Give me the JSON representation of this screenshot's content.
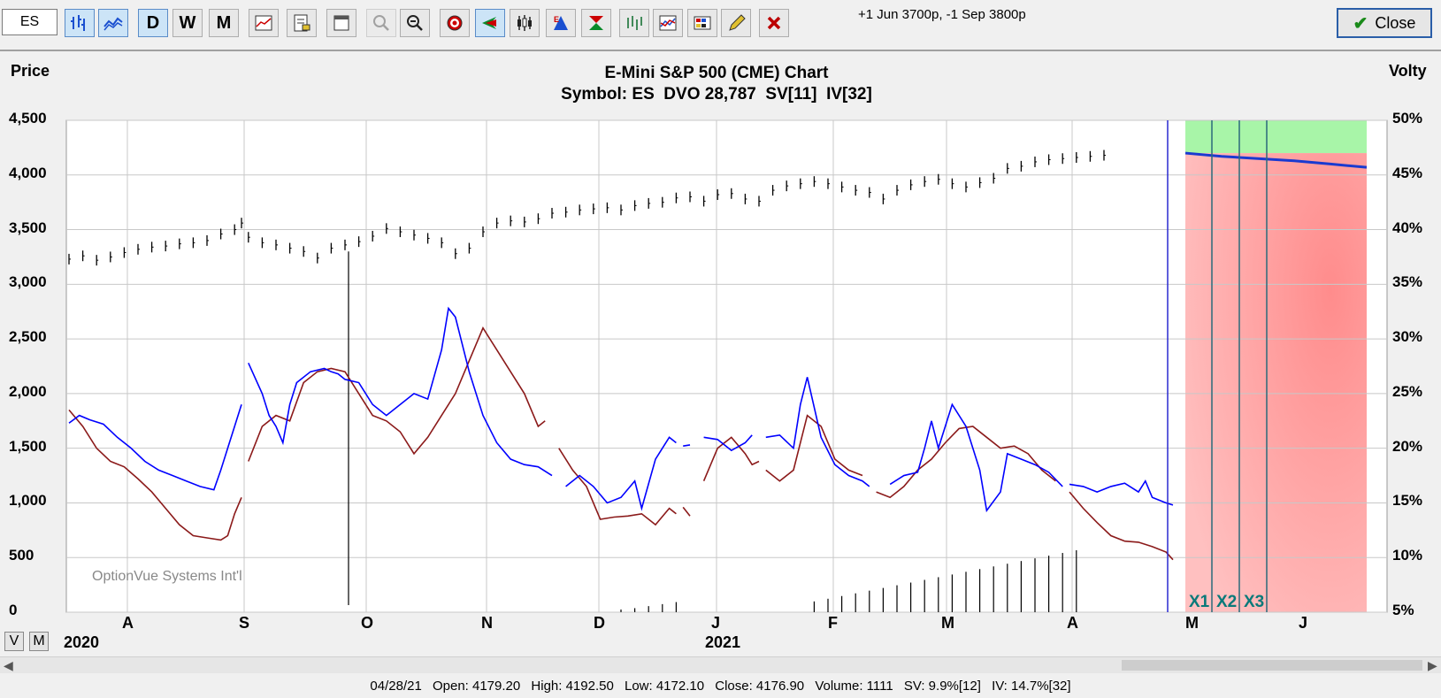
{
  "toolbar": {
    "symbol": "ES",
    "period_buttons": [
      "D",
      "W",
      "M"
    ],
    "position_note": "+1 Jun 3700p, -1 Sep 3800p",
    "close_label": "Close"
  },
  "chart": {
    "title": "E-Mini S&P 500 (CME) Chart",
    "subtitle": "Symbol: ES  DVO 28,787  SV[11]  IV[32]",
    "left_axis_title": "Price",
    "right_axis_title": "Volty",
    "watermark": "OptionVue Systems Int'l",
    "markers": [
      "X1",
      "X2",
      "X3"
    ],
    "year_labels": [
      "2020",
      "2021"
    ],
    "view_buttons": [
      "V",
      "M"
    ]
  },
  "status_bar": {
    "date": "04/28/21",
    "open": "Open: 4179.20",
    "high": "High: 4192.50",
    "low": "Low: 4172.10",
    "close": "Close: 4176.90",
    "volume": "Volume: 1111",
    "sv": "SV: 9.9%[12]",
    "iv": "IV: 14.7%[32]"
  },
  "colors": {
    "price_bars": "#000000",
    "sv_line": "#0000ff",
    "iv_line": "#8b1a1a",
    "projection_green": "#a8f5a8",
    "projection_red": "#ffaaaa",
    "marker_text": "#0a7a7a"
  },
  "chart_data": {
    "type": "line",
    "xaxis_months": [
      "A",
      "S",
      "O",
      "N",
      "D",
      "J",
      "F",
      "M",
      "A",
      "M",
      "J"
    ],
    "y_left": {
      "label": "Price",
      "ticks": [
        "4,500",
        "4,000",
        "3,500",
        "3,000",
        "2,500",
        "2,000",
        "1,500",
        "1,000",
        "500",
        "0"
      ],
      "ylim": [
        0,
        4500
      ]
    },
    "y_right": {
      "label": "Volty",
      "ticks": [
        "50%",
        "45%",
        "40%",
        "35%",
        "30%",
        "25%",
        "20%",
        "15%",
        "10%",
        "5%"
      ],
      "ylim": [
        5,
        50
      ]
    },
    "price_series": [
      [
        0,
        3230
      ],
      [
        4,
        3260
      ],
      [
        8,
        3220
      ],
      [
        12,
        3250
      ],
      [
        16,
        3290
      ],
      [
        20,
        3320
      ],
      [
        24,
        3340
      ],
      [
        28,
        3350
      ],
      [
        32,
        3370
      ],
      [
        36,
        3380
      ],
      [
        40,
        3400
      ],
      [
        44,
        3460
      ],
      [
        48,
        3500
      ],
      [
        50,
        3560
      ],
      [
        52,
        3430
      ],
      [
        56,
        3380
      ],
      [
        60,
        3360
      ],
      [
        64,
        3330
      ],
      [
        68,
        3300
      ],
      [
        72,
        3240
      ],
      [
        76,
        3330
      ],
      [
        80,
        3360
      ],
      [
        84,
        3390
      ],
      [
        88,
        3440
      ],
      [
        92,
        3510
      ],
      [
        96,
        3480
      ],
      [
        100,
        3450
      ],
      [
        104,
        3420
      ],
      [
        108,
        3380
      ],
      [
        112,
        3280
      ],
      [
        116,
        3330
      ],
      [
        120,
        3480
      ],
      [
        124,
        3560
      ],
      [
        128,
        3580
      ],
      [
        132,
        3570
      ],
      [
        136,
        3600
      ],
      [
        140,
        3650
      ],
      [
        144,
        3660
      ],
      [
        148,
        3680
      ],
      [
        152,
        3690
      ],
      [
        156,
        3700
      ],
      [
        160,
        3680
      ],
      [
        164,
        3720
      ],
      [
        168,
        3740
      ],
      [
        172,
        3750
      ],
      [
        176,
        3790
      ],
      [
        180,
        3800
      ],
      [
        184,
        3760
      ],
      [
        188,
        3820
      ],
      [
        192,
        3830
      ],
      [
        196,
        3780
      ],
      [
        200,
        3760
      ],
      [
        204,
        3860
      ],
      [
        208,
        3900
      ],
      [
        212,
        3920
      ],
      [
        216,
        3940
      ],
      [
        220,
        3920
      ],
      [
        224,
        3890
      ],
      [
        228,
        3860
      ],
      [
        232,
        3840
      ],
      [
        236,
        3780
      ],
      [
        240,
        3860
      ],
      [
        244,
        3910
      ],
      [
        248,
        3940
      ],
      [
        252,
        3960
      ],
      [
        256,
        3920
      ],
      [
        260,
        3890
      ],
      [
        264,
        3930
      ],
      [
        268,
        3970
      ],
      [
        272,
        4060
      ],
      [
        276,
        4080
      ],
      [
        280,
        4120
      ],
      [
        284,
        4140
      ],
      [
        288,
        4150
      ],
      [
        292,
        4160
      ],
      [
        296,
        4170
      ],
      [
        300,
        4180
      ]
    ],
    "sv_series": [
      [
        [
          0,
          1730
        ],
        [
          3,
          1800
        ],
        [
          6,
          1760
        ],
        [
          10,
          1720
        ],
        [
          14,
          1600
        ],
        [
          18,
          1500
        ],
        [
          22,
          1380
        ],
        [
          26,
          1300
        ],
        [
          30,
          1250
        ],
        [
          34,
          1200
        ],
        [
          38,
          1150
        ],
        [
          42,
          1120
        ],
        [
          44,
          1300
        ],
        [
          46,
          1500
        ],
        [
          48,
          1700
        ],
        [
          50,
          1900
        ]
      ],
      [
        [
          52,
          2280
        ],
        [
          56,
          2000
        ],
        [
          58,
          1800
        ],
        [
          60,
          1700
        ],
        [
          62,
          1550
        ],
        [
          64,
          1900
        ],
        [
          66,
          2100
        ],
        [
          70,
          2200
        ],
        [
          74,
          2230
        ],
        [
          76,
          2200
        ],
        [
          78,
          2180
        ],
        [
          80,
          2130
        ],
        [
          84,
          2100
        ],
        [
          88,
          1900
        ],
        [
          92,
          1800
        ],
        [
          96,
          1900
        ],
        [
          100,
          2000
        ],
        [
          104,
          1950
        ],
        [
          108,
          2400
        ],
        [
          110,
          2780
        ],
        [
          112,
          2700
        ],
        [
          116,
          2200
        ],
        [
          120,
          1800
        ],
        [
          124,
          1550
        ],
        [
          128,
          1400
        ],
        [
          132,
          1350
        ],
        [
          136,
          1330
        ],
        [
          140,
          1250
        ]
      ],
      [
        [
          144,
          1150
        ],
        [
          148,
          1250
        ],
        [
          152,
          1150
        ],
        [
          156,
          1000
        ],
        [
          160,
          1050
        ],
        [
          164,
          1200
        ],
        [
          166,
          950
        ],
        [
          170,
          1400
        ],
        [
          174,
          1600
        ],
        [
          176,
          1550
        ]
      ],
      [
        [
          178,
          1520
        ],
        [
          180,
          1530
        ]
      ],
      [
        [
          184,
          1600
        ],
        [
          188,
          1580
        ],
        [
          192,
          1480
        ],
        [
          196,
          1550
        ],
        [
          198,
          1620
        ]
      ],
      [
        [
          202,
          1600
        ],
        [
          206,
          1620
        ],
        [
          210,
          1500
        ],
        [
          212,
          1900
        ],
        [
          214,
          2150
        ],
        [
          218,
          1600
        ],
        [
          222,
          1350
        ],
        [
          226,
          1250
        ],
        [
          230,
          1200
        ],
        [
          232,
          1150
        ]
      ],
      [
        [
          238,
          1170
        ],
        [
          242,
          1250
        ],
        [
          246,
          1280
        ],
        [
          248,
          1500
        ],
        [
          250,
          1750
        ],
        [
          252,
          1500
        ],
        [
          256,
          1900
        ],
        [
          260,
          1700
        ],
        [
          264,
          1300
        ],
        [
          266,
          930
        ],
        [
          270,
          1100
        ],
        [
          272,
          1450
        ],
        [
          276,
          1400
        ],
        [
          280,
          1350
        ],
        [
          284,
          1280
        ],
        [
          288,
          1150
        ]
      ],
      [
        [
          290,
          1170
        ],
        [
          294,
          1150
        ],
        [
          298,
          1100
        ],
        [
          302,
          1150
        ],
        [
          306,
          1180
        ],
        [
          310,
          1100
        ],
        [
          312,
          1200
        ],
        [
          314,
          1050
        ],
        [
          318,
          1000
        ],
        [
          320,
          980
        ]
      ]
    ],
    "iv_series": [
      [
        [
          0,
          1850
        ],
        [
          4,
          1700
        ],
        [
          8,
          1500
        ],
        [
          12,
          1380
        ],
        [
          16,
          1330
        ],
        [
          20,
          1220
        ],
        [
          24,
          1100
        ],
        [
          28,
          950
        ],
        [
          32,
          800
        ],
        [
          36,
          700
        ],
        [
          40,
          680
        ],
        [
          44,
          660
        ],
        [
          46,
          700
        ],
        [
          48,
          900
        ],
        [
          50,
          1050
        ]
      ],
      [
        [
          52,
          1380
        ],
        [
          56,
          1700
        ],
        [
          60,
          1800
        ],
        [
          64,
          1750
        ],
        [
          68,
          2100
        ],
        [
          72,
          2200
        ],
        [
          76,
          2230
        ],
        [
          80,
          2200
        ],
        [
          84,
          2000
        ],
        [
          88,
          1800
        ],
        [
          92,
          1750
        ],
        [
          96,
          1650
        ],
        [
          100,
          1450
        ],
        [
          104,
          1600
        ],
        [
          108,
          1800
        ],
        [
          112,
          2000
        ],
        [
          116,
          2300
        ],
        [
          120,
          2600
        ],
        [
          124,
          2400
        ],
        [
          128,
          2200
        ],
        [
          132,
          2000
        ],
        [
          136,
          1700
        ],
        [
          138,
          1750
        ]
      ],
      [
        [
          142,
          1500
        ],
        [
          146,
          1300
        ],
        [
          150,
          1150
        ],
        [
          154,
          850
        ],
        [
          158,
          870
        ],
        [
          162,
          880
        ],
        [
          166,
          900
        ],
        [
          170,
          800
        ],
        [
          174,
          950
        ],
        [
          176,
          900
        ]
      ],
      [
        [
          178,
          960
        ],
        [
          180,
          880
        ]
      ],
      [
        [
          184,
          1200
        ],
        [
          188,
          1500
        ],
        [
          192,
          1600
        ],
        [
          196,
          1450
        ],
        [
          198,
          1350
        ],
        [
          200,
          1380
        ]
      ],
      [
        [
          202,
          1300
        ],
        [
          206,
          1200
        ],
        [
          210,
          1300
        ],
        [
          214,
          1800
        ],
        [
          218,
          1700
        ],
        [
          222,
          1400
        ],
        [
          226,
          1300
        ],
        [
          230,
          1250
        ]
      ],
      [
        [
          234,
          1100
        ],
        [
          238,
          1050
        ],
        [
          242,
          1150
        ],
        [
          246,
          1300
        ],
        [
          250,
          1400
        ],
        [
          254,
          1550
        ],
        [
          258,
          1680
        ],
        [
          262,
          1700
        ],
        [
          266,
          1600
        ],
        [
          270,
          1500
        ],
        [
          274,
          1520
        ],
        [
          278,
          1450
        ],
        [
          282,
          1300
        ],
        [
          286,
          1200
        ]
      ],
      [
        [
          290,
          1100
        ],
        [
          294,
          950
        ],
        [
          298,
          820
        ],
        [
          302,
          700
        ],
        [
          306,
          650
        ],
        [
          310,
          640
        ],
        [
          314,
          600
        ],
        [
          318,
          550
        ],
        [
          320,
          480
        ]
      ]
    ],
    "projected_price": [
      [
        0,
        4200
      ],
      [
        40,
        4170
      ],
      [
        80,
        4150
      ],
      [
        120,
        4130
      ],
      [
        160,
        4100
      ],
      [
        200,
        4070
      ]
    ],
    "volume_heights": [
      [
        160,
        8
      ],
      [
        164,
        12
      ],
      [
        168,
        18
      ],
      [
        172,
        24
      ],
      [
        176,
        30
      ],
      [
        216,
        32
      ],
      [
        220,
        40
      ],
      [
        224,
        48
      ],
      [
        228,
        56
      ],
      [
        232,
        64
      ],
      [
        236,
        72
      ],
      [
        240,
        80
      ],
      [
        244,
        88
      ],
      [
        248,
        96
      ],
      [
        252,
        104
      ],
      [
        256,
        112
      ],
      [
        260,
        120
      ],
      [
        264,
        128
      ],
      [
        268,
        136
      ],
      [
        272,
        144
      ],
      [
        276,
        152
      ],
      [
        280,
        160
      ],
      [
        284,
        168
      ],
      [
        288,
        176
      ],
      [
        292,
        184
      ]
    ]
  }
}
